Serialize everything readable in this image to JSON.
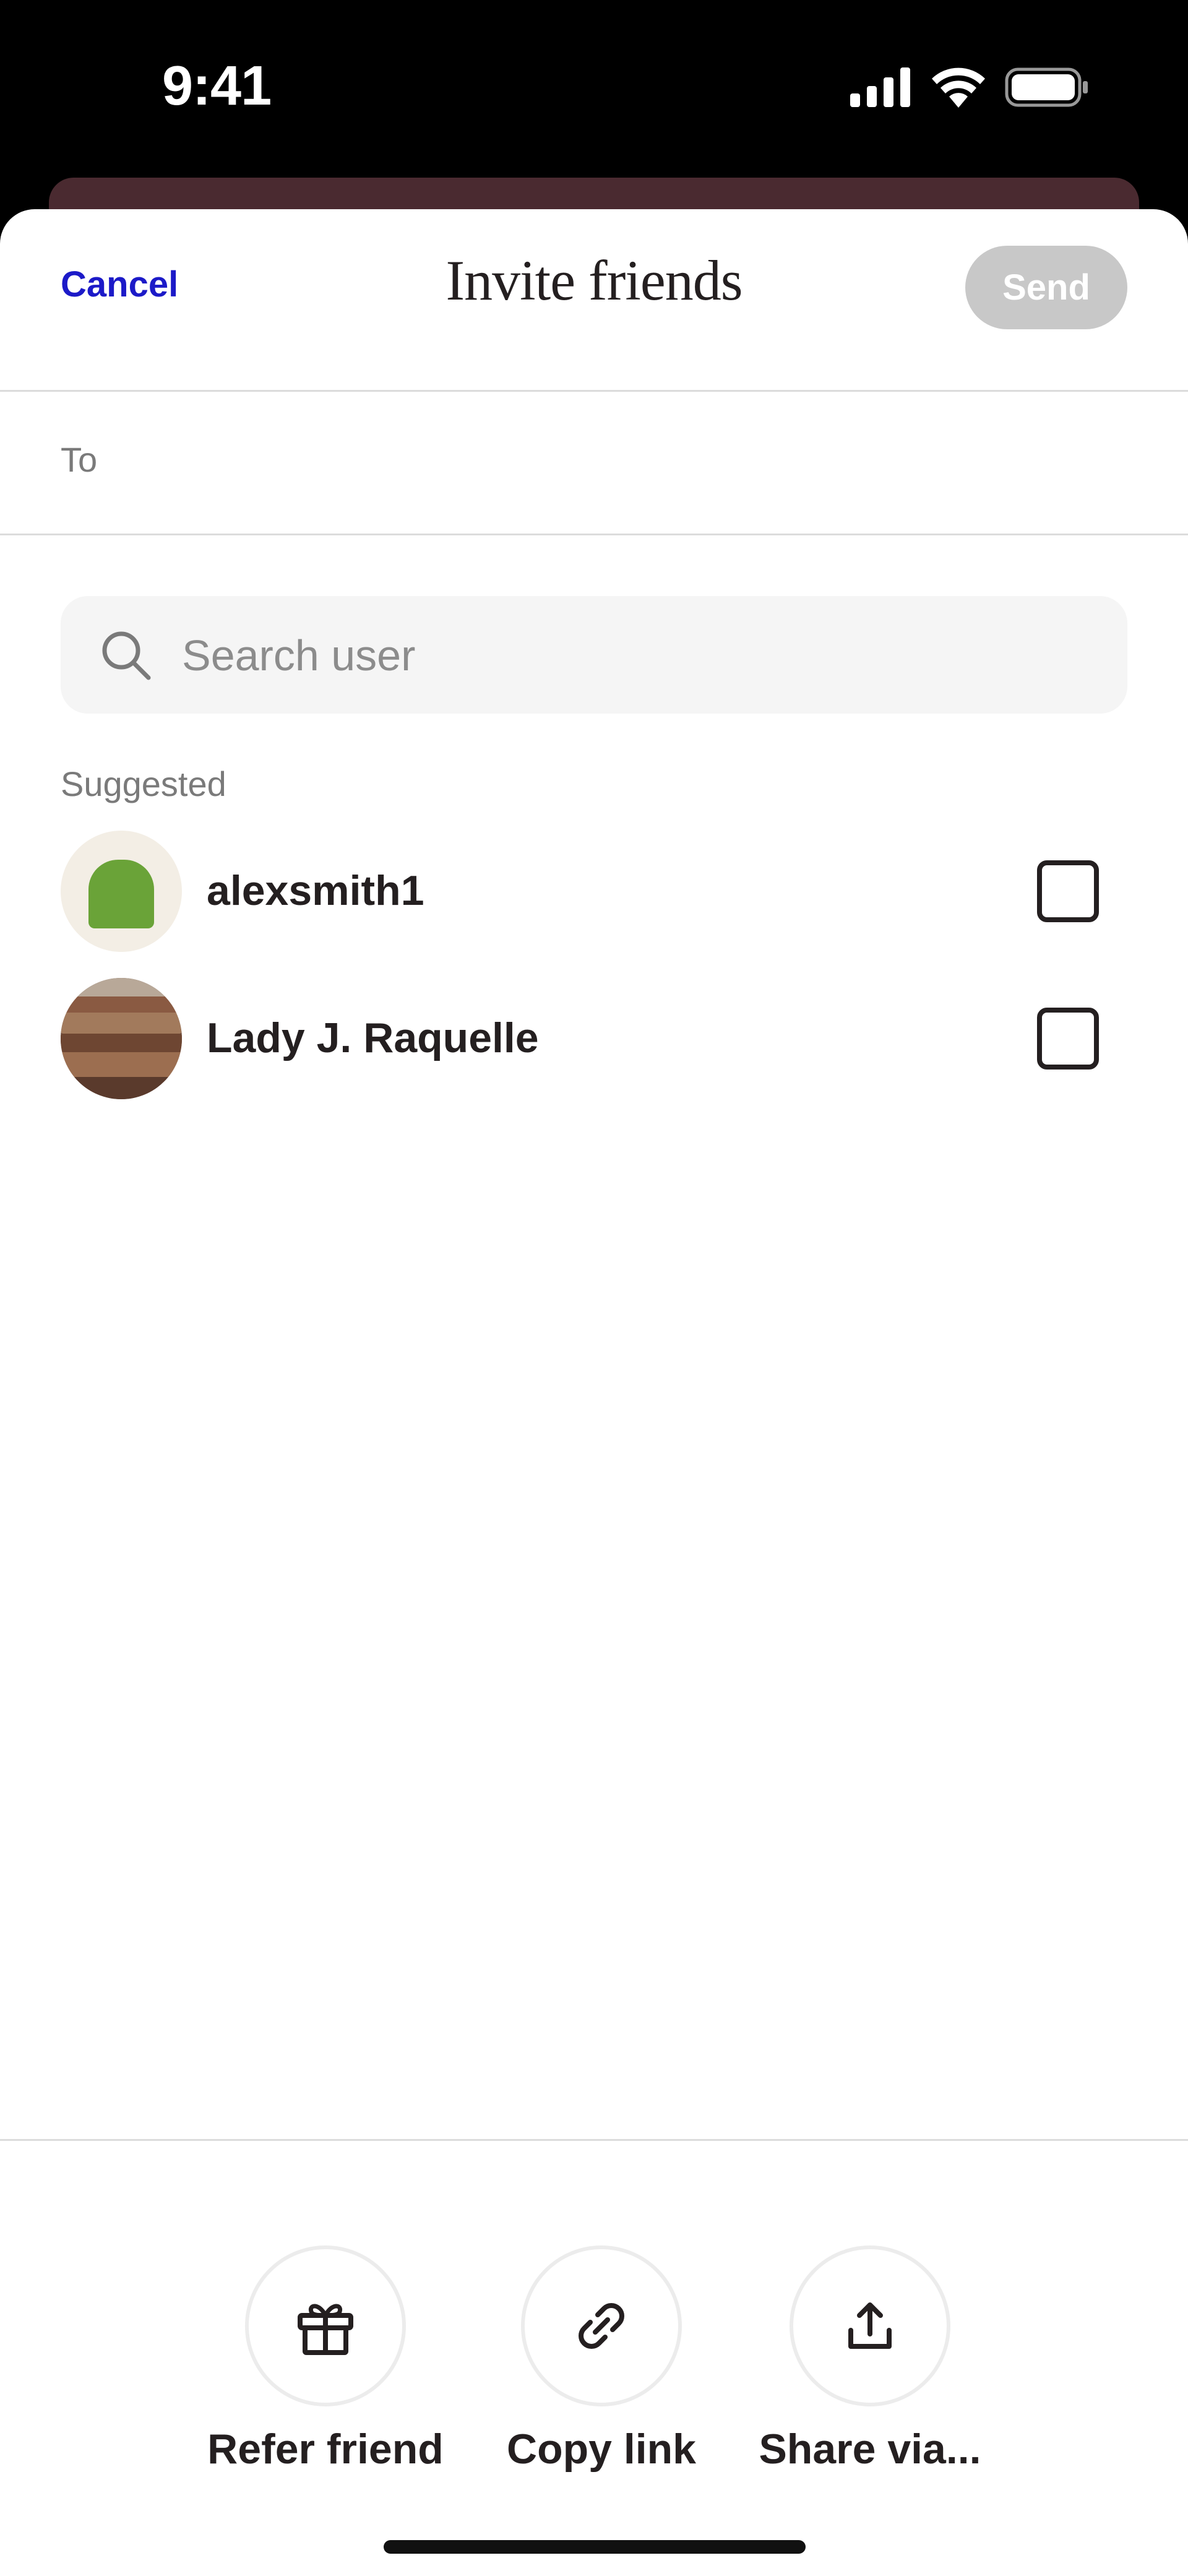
{
  "status_bar": {
    "time": "9:41",
    "icons": [
      "signal-icon",
      "wifi-icon",
      "battery-icon"
    ]
  },
  "nav": {
    "cancel_label": "Cancel",
    "title": "Invite friends",
    "send_label": "Send"
  },
  "to_field": {
    "label": "To"
  },
  "search": {
    "placeholder": "Search user",
    "icon": "search-icon"
  },
  "suggested": {
    "heading": "Suggested",
    "users": [
      {
        "name": "alexsmith1",
        "checked": false,
        "avatar": "green-shape-avatar"
      },
      {
        "name": "Lady J. Raquelle",
        "checked": false,
        "avatar": "books-avatar"
      }
    ]
  },
  "actions": [
    {
      "label": "Refer friend",
      "icon": "gift-icon"
    },
    {
      "label": "Copy link",
      "icon": "link-icon"
    },
    {
      "label": "Share via...",
      "icon": "share-icon"
    }
  ],
  "colors": {
    "accent": "#1c1ac8",
    "send_disabled": "#c8c8c8",
    "text_primary": "#241f20",
    "text_secondary": "#7a7a7a",
    "avatar_green": "#6aa338"
  }
}
